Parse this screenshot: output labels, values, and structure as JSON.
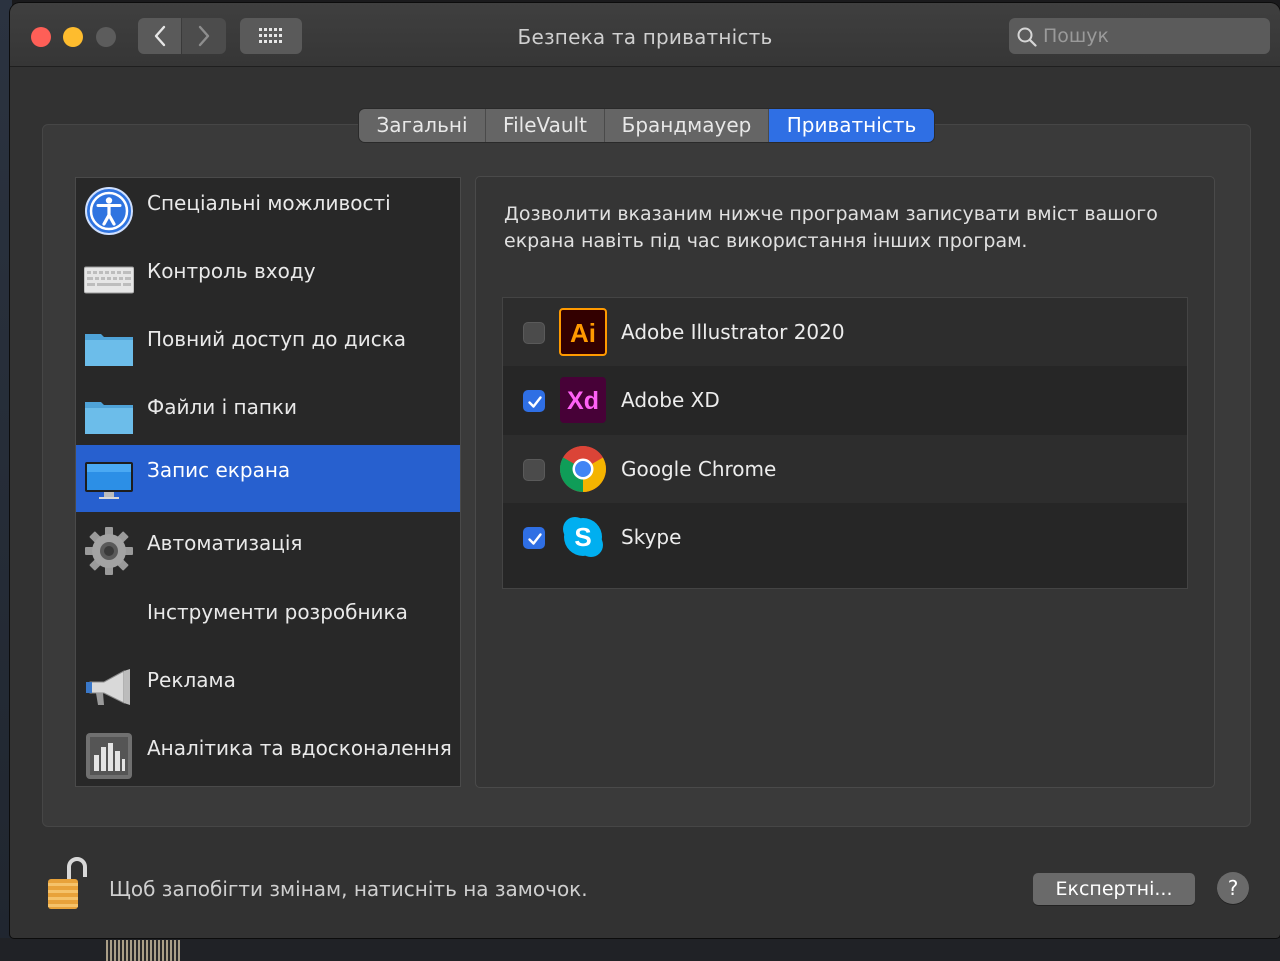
{
  "window": {
    "title": "Безпека та приватність",
    "search_placeholder": "Пошук"
  },
  "tabs": [
    {
      "label": "Загальні",
      "active": false
    },
    {
      "label": "FileVault",
      "active": false
    },
    {
      "label": "Брандмауер",
      "active": false
    },
    {
      "label": "Приватність",
      "active": true
    }
  ],
  "sidebar": {
    "items": [
      {
        "label": "Спеціальні можливості",
        "icon": "accessibility-icon",
        "selected": false
      },
      {
        "label": "Контроль входу",
        "icon": "keyboard-icon",
        "selected": false
      },
      {
        "label": "Повний доступ до диска",
        "icon": "folder-icon",
        "selected": false
      },
      {
        "label": "Файли і папки",
        "icon": "folder-icon",
        "selected": false
      },
      {
        "label": "Запис екрана",
        "icon": "display-icon",
        "selected": true
      },
      {
        "label": "Автоматизація",
        "icon": "gear-icon",
        "selected": false
      },
      {
        "label": "Інструменти розробника",
        "icon": "",
        "selected": false
      },
      {
        "label": "Реклама",
        "icon": "megaphone-icon",
        "selected": false
      },
      {
        "label": "Аналітика та вдосконалення",
        "icon": "chart-icon",
        "selected": false
      }
    ]
  },
  "main": {
    "description": "Дозволити вказаним нижче програмам записувати вміст вашого екрана навіть під час використання інших програм.",
    "apps": [
      {
        "name": "Adobe Illustrator 2020",
        "checked": false,
        "icon": "illustrator-icon",
        "icon_text": "Ai"
      },
      {
        "name": "Adobe XD",
        "checked": true,
        "icon": "xd-icon",
        "icon_text": "Xd"
      },
      {
        "name": "Google Chrome",
        "checked": false,
        "icon": "chrome-icon"
      },
      {
        "name": "Skype",
        "checked": true,
        "icon": "skype-icon",
        "icon_text": "S"
      }
    ]
  },
  "footer": {
    "lock_message": "Щоб запобігти змінам, натисніть на замочок.",
    "advanced_button": "Експертні...",
    "help_button": "?"
  },
  "colors": {
    "accent": "#2f6fe4",
    "selection": "#2760cf",
    "window_bg": "#323232"
  }
}
